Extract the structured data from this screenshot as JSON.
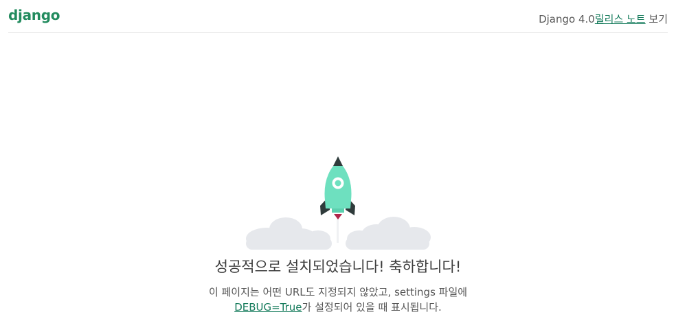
{
  "header": {
    "logo": "django",
    "version_text": "Django 4.0",
    "release_notes_link": "릴리스 노트",
    "view_text": " 보기"
  },
  "main": {
    "title": "성공적으로 설치되었습니다! 축하합니다!",
    "description_line1": "이 페이지는 어떤 URL도 지정되지 않았고, settings 파일에",
    "debug_link": "DEBUG=True",
    "description_line2_rest": "가 설정되어 있을 때 표시됩니다."
  },
  "colors": {
    "brand": "#228b5e",
    "rocket": "#6ee0bf",
    "cloud": "#e6e8ec",
    "link": "#137a5a"
  },
  "icons": {
    "rocket": "rocket-icon",
    "clouds": "cloud-icon"
  }
}
